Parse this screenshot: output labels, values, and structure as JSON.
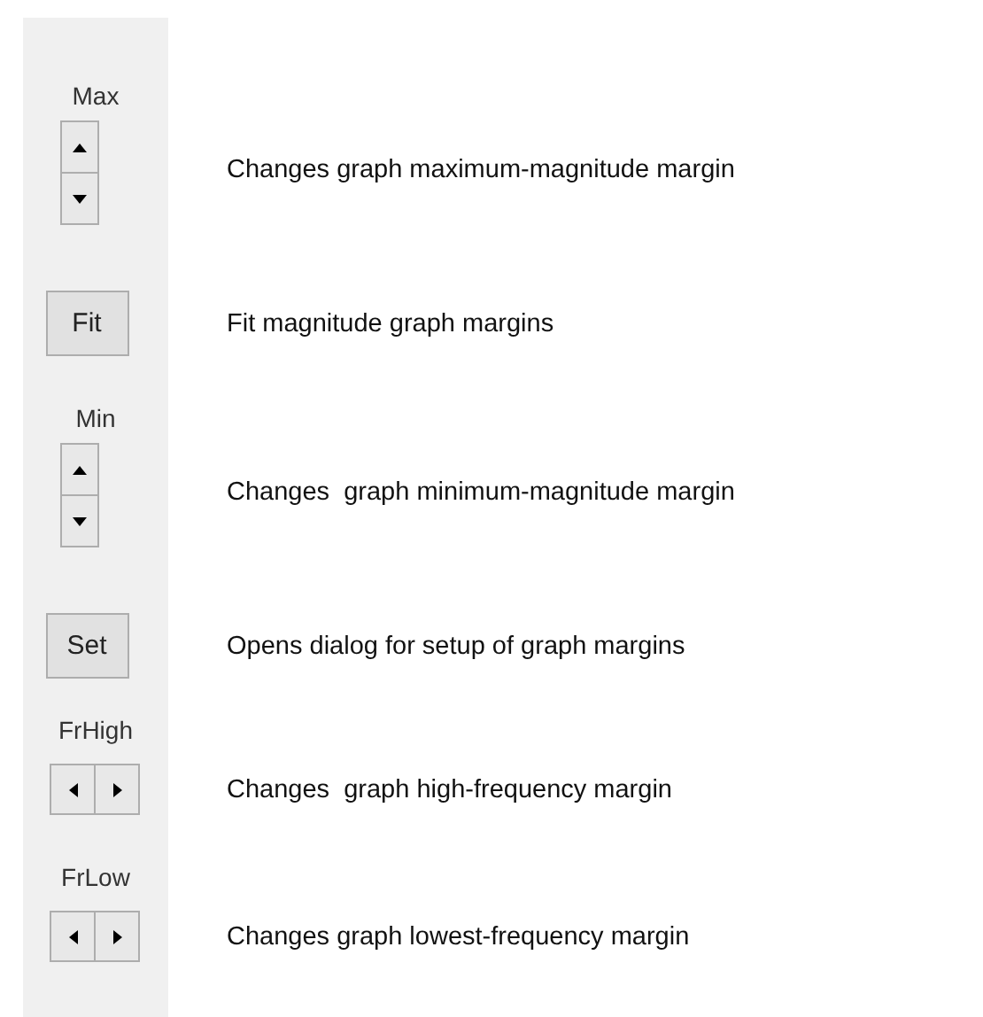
{
  "controls": [
    {
      "kind": "vspin",
      "label": "Max",
      "description": "Changes graph maximum-magnitude margin"
    },
    {
      "kind": "button",
      "text": "Fit",
      "description": "Fit magnitude graph margins"
    },
    {
      "kind": "vspin",
      "label": "Min",
      "description": "Changes  graph minimum-magnitude margin"
    },
    {
      "kind": "button",
      "text": "Set",
      "description": "Opens dialog for setup of graph margins"
    },
    {
      "kind": "hspin",
      "label": "FrHigh",
      "description": "Changes  graph high-frequency margin"
    },
    {
      "kind": "hspin",
      "label": "FrLow",
      "description": "Changes graph lowest-frequency margin"
    }
  ]
}
